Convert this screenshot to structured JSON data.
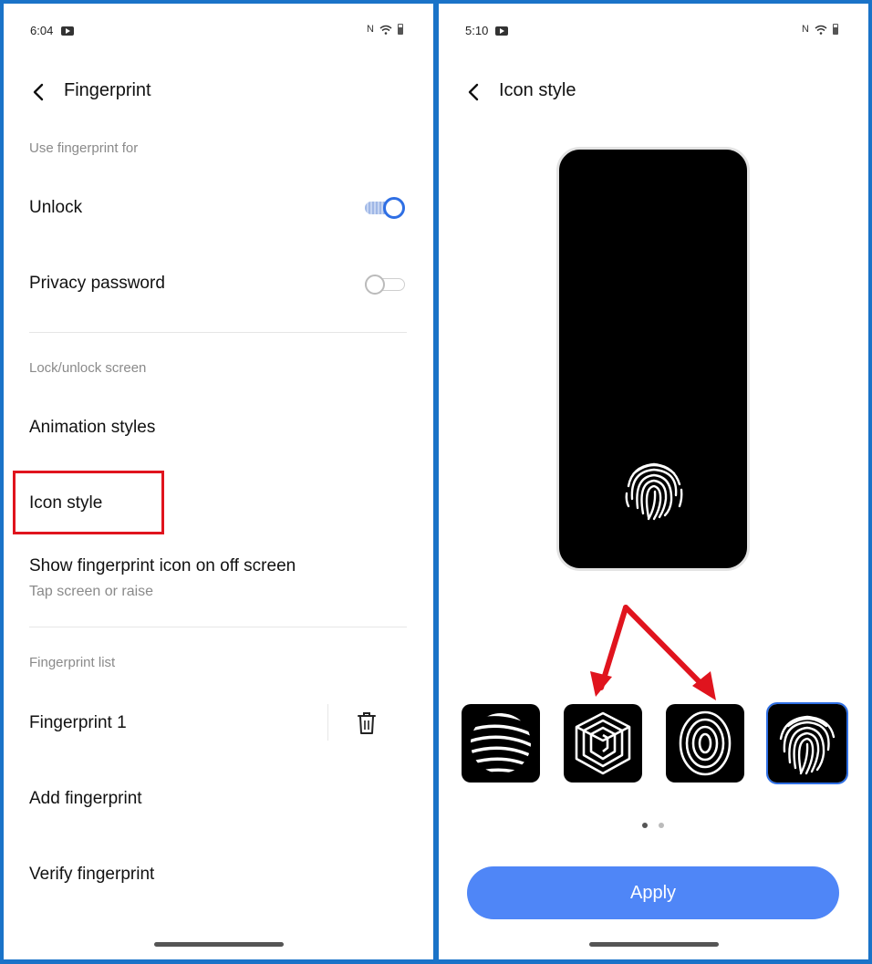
{
  "left": {
    "status": {
      "time": "6:04"
    },
    "title": "Fingerprint",
    "sections": {
      "use_for": "Use fingerprint for",
      "lock_unlock": "Lock/unlock screen",
      "fingerprint_list": "Fingerprint list"
    },
    "rows": {
      "unlock": "Unlock",
      "privacy_password": "Privacy password",
      "animation_styles": "Animation styles",
      "icon_style": "Icon style",
      "show_icon_off_screen": "Show fingerprint icon on off screen",
      "show_icon_off_screen_sub": "Tap screen or raise",
      "fingerprint_1": "Fingerprint 1",
      "add_fingerprint": "Add fingerprint",
      "verify_fingerprint": "Verify fingerprint"
    },
    "toggles": {
      "unlock": true,
      "privacy_password": false
    }
  },
  "right": {
    "status": {
      "time": "5:10"
    },
    "title": "Icon style",
    "icon_options": [
      "sphere-stripes-icon",
      "hexagon-lines-icon",
      "oval-fingerprint-icon",
      "classic-fingerprint-icon"
    ],
    "selected_index": 3,
    "page_dots": 2,
    "active_dot": 0,
    "apply_label": "Apply"
  },
  "colors": {
    "accent": "#2f6fe4",
    "apply_button": "#4f86f7",
    "highlight": "#e0141e",
    "frame": "#1a73c8"
  }
}
